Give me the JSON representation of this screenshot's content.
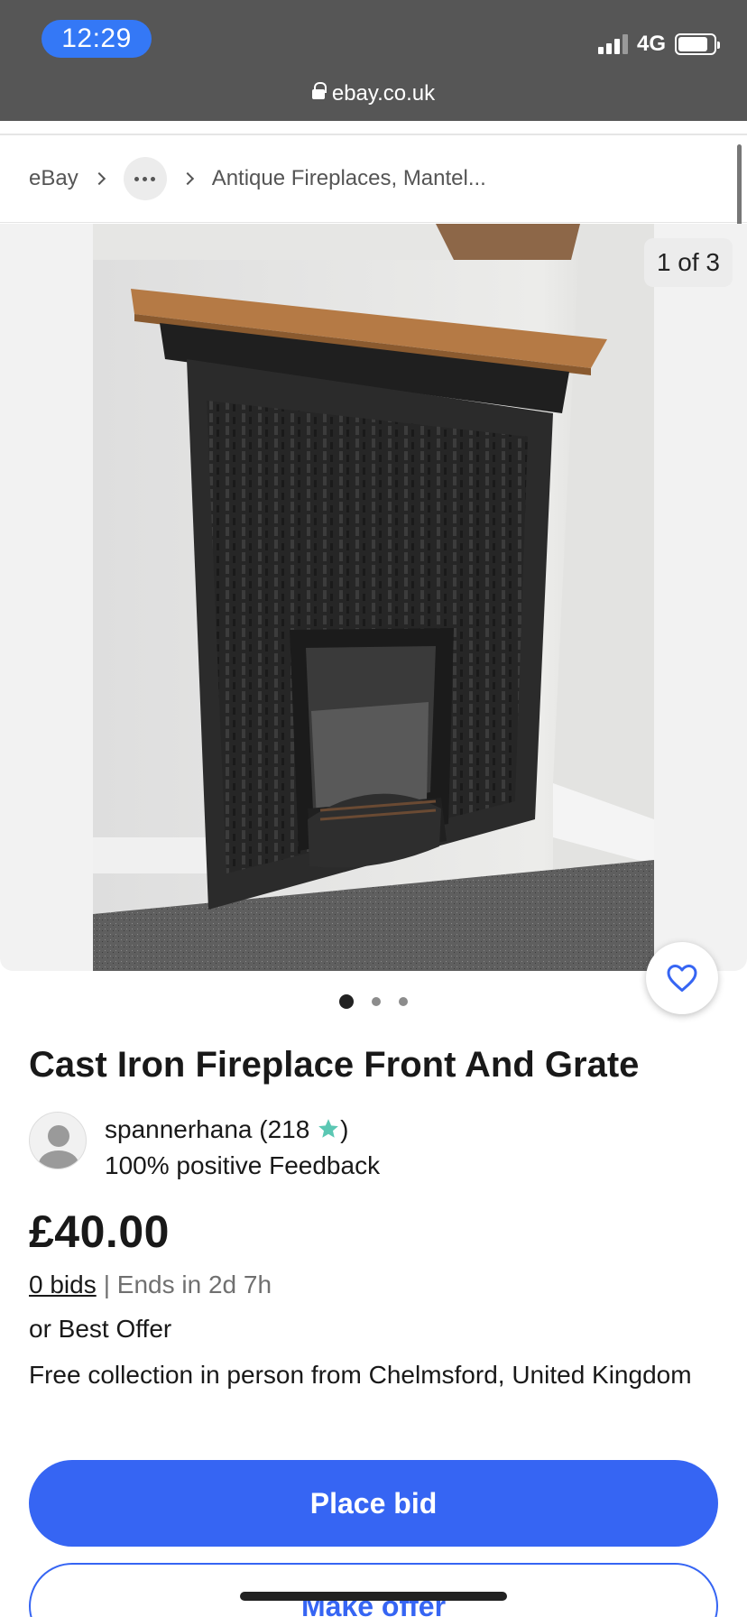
{
  "status_bar": {
    "time": "12:29",
    "network": "4G",
    "battery_level": 0.85,
    "signal_icon": "cellular-signal-icon",
    "battery_icon": "battery-icon"
  },
  "browser": {
    "url": "ebay.co.uk",
    "lock_icon": "lock-icon"
  },
  "breadcrumb": {
    "root": "eBay",
    "more_icon": "ellipsis-icon",
    "category": "Antique Fireplaces, Mantel..."
  },
  "gallery": {
    "counter": "1 of 3",
    "total_images": 3,
    "active_index": 1,
    "favorite_icon": "heart-icon"
  },
  "item": {
    "title": "Cast Iron Fireplace Front And Grate",
    "seller_name": "spannerhana (218",
    "seller_close": ")",
    "seller_star_icon": "star-icon",
    "seller_feedback": "100% positive Feedback",
    "price": "£40.00",
    "bids": "0 bids",
    "ends": "| Ends in 2d 7h",
    "best_offer": "or Best Offer",
    "collection": "Free collection in person from Chelmsford, United Kingdom"
  },
  "actions": {
    "place_bid": "Place bid",
    "make_offer": "Make offer"
  },
  "colors": {
    "accent": "#3665f3",
    "status_bar_bg": "#565656",
    "time_pill": "#3478f6",
    "star": "#5bc7b3"
  }
}
